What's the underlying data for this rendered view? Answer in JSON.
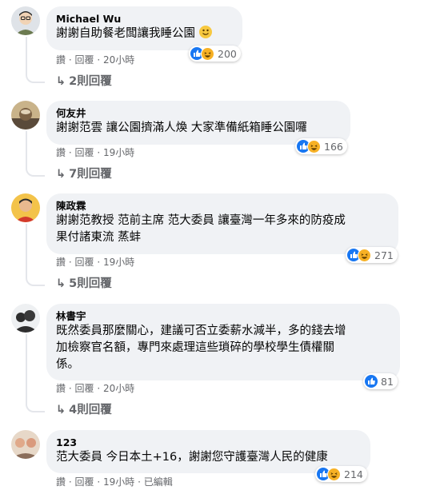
{
  "comments": [
    {
      "author": "Michael Wu",
      "text": "謝謝自助餐老闆讓我睡公園",
      "reaction_count": "200",
      "actions": {
        "like": "讚",
        "reply": "回覆",
        "time": "20小時"
      },
      "replies": "2則回覆"
    },
    {
      "author": "何友井",
      "text": "謝謝范雲 讓公園擠滿人煥 大家準備紙箱睡公園囉",
      "reaction_count": "166",
      "actions": {
        "like": "讚",
        "reply": "回覆",
        "time": "19小時"
      },
      "replies": "7則回覆"
    },
    {
      "author": "陳政霖",
      "text_lines": [
        "謝謝范教授 范前主席 范大委員 讓臺灣一年多來的防疫成",
        "果付諸東流 蒸蚌"
      ],
      "reaction_count": "271",
      "actions": {
        "like": "讚",
        "reply": "回覆",
        "time": "19小時"
      },
      "replies": "5則回覆"
    },
    {
      "author": "林書宇",
      "text_lines": [
        "既然委員那麼關心，建議可否立委薪水減半，多的錢去增",
        "加檢察官名額，專門來處理這些瑣碎的學校學生債權關",
        "係。"
      ],
      "reaction_count": "81",
      "actions": {
        "like": "讚",
        "reply": "回覆",
        "time": "20小時"
      },
      "replies": "4則回覆"
    },
    {
      "author": "123",
      "text": "范大委員 今日本土+16，謝謝您守護臺灣人民的健康",
      "reaction_count": "214",
      "actions": {
        "like": "讚",
        "reply": "回覆",
        "time": "19小時",
        "edited": "已編輯"
      }
    }
  ],
  "separator": "·",
  "colors": {
    "like": "#1877f2",
    "haha": "#f7b125",
    "bubble": "#f0f2f5",
    "meta": "#65676b"
  },
  "icons": [
    "like-reaction-icon",
    "haha-reaction-icon",
    "reply-arrow-icon",
    "smile-emoji-icon"
  ]
}
